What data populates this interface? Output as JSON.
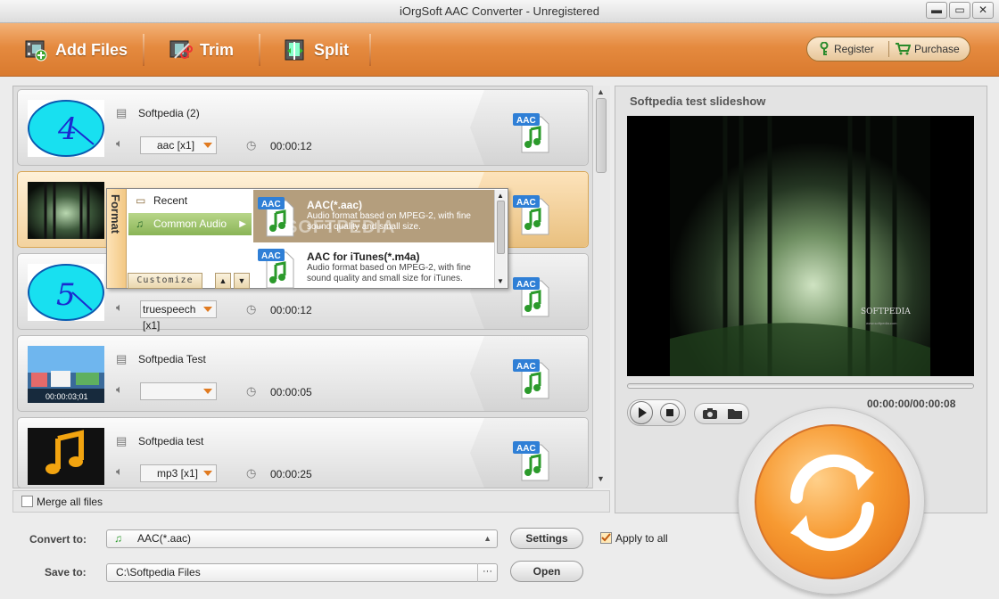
{
  "window": {
    "title": "iOrgSoft AAC Converter - Unregistered",
    "min_label": "▬",
    "max_label": "▭",
    "close_label": "✕"
  },
  "toolbar": {
    "add_files": "Add Files",
    "trim": "Trim",
    "split": "Split",
    "register": "Register",
    "purchase": "Purchase"
  },
  "files": [
    {
      "name": "Softpedia (2)",
      "format": "aac [x1]",
      "duration": "00:00:12",
      "thumb": "clock-4"
    },
    {
      "name": "",
      "format": "",
      "duration": "",
      "thumb": "forest"
    },
    {
      "name": "",
      "format": "truespeech [x1]",
      "duration": "00:00:12",
      "thumb": "clock-5"
    },
    {
      "name": "Softpedia Test",
      "format": "",
      "duration": "00:00:05",
      "thumb": "beach",
      "thumb_time": "00:00:03;01"
    },
    {
      "name": "Softpedia test",
      "format": "mp3 [x1]",
      "duration": "00:00:25",
      "thumb": "music-note"
    }
  ],
  "output_badge": "AAC",
  "popup": {
    "header": "Format",
    "categories": [
      {
        "label": "Recent",
        "icon": "folder-icon"
      },
      {
        "label": "Common Audio",
        "icon": "music-icon"
      }
    ],
    "customize": "Customize",
    "formats": [
      {
        "name": "AAC(*.aac)",
        "desc": "Audio format based on MPEG-2, with fine sound quality and small size."
      },
      {
        "name": "AAC for iTunes(*.m4a)",
        "desc": "Audio format based on MPEG-2, with fine sound quality and small size for iTunes."
      }
    ],
    "watermark": "SOFTPEDIA"
  },
  "merge_label": "Merge all files",
  "convert_to": {
    "label": "Convert to:",
    "value": "AAC(*.aac)",
    "settings": "Settings",
    "apply_all": "Apply to all"
  },
  "save_to": {
    "label": "Save to:",
    "value": "C:\\Softpedia Files",
    "browse": "···",
    "open": "Open"
  },
  "preview": {
    "title": "Softpedia test slideshow",
    "timecode": "00:00:00/00:00:08",
    "video_caption": "SOFTPEDIA",
    "video_url": "www.softpedia.com"
  },
  "colors": {
    "accent": "#e58a3f",
    "convert": "#f79a32"
  }
}
